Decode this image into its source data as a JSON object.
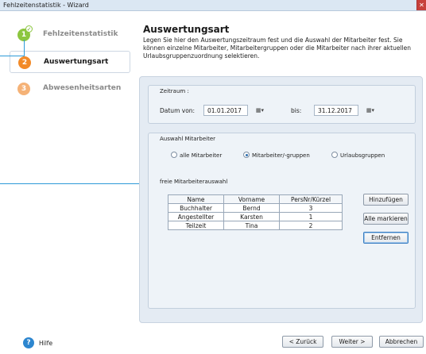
{
  "window": {
    "title": "Fehlzeitenstatistik - Wizard",
    "close_icon": "close-icon"
  },
  "sidebar": {
    "steps": [
      {
        "number": "1",
        "label": "Fehlzeitenstatistik",
        "state": "done"
      },
      {
        "number": "2",
        "label": "Auswertungsart",
        "state": "active"
      },
      {
        "number": "3",
        "label": "Abwesenheitsarten",
        "state": "todo"
      }
    ]
  },
  "header": {
    "title": "Auswertungsart",
    "description": "Legen Sie hier den Auswertungszeitraum fest und die Auswahl der Mitarbeiter fest. Sie können einzelne Mitarbeiter, Mitarbeitergruppen oder die Mitarbeiter nach ihrer aktuellen Urlaubsgruppenzuordnung selektieren."
  },
  "zeitraum": {
    "group_title": "Zeitraum :",
    "from_label": "Datum von:",
    "from_value": "01.01.2017",
    "to_label": "bis:",
    "to_value": "31.12.2017",
    "calendar_icon": "calendar-dropdown-icon"
  },
  "auswahl": {
    "group_title": "Auswahl Mitarbeiter",
    "options": [
      {
        "label": "alle Mitarbeiter",
        "checked": false
      },
      {
        "label": "Mitarbeiter/-gruppen",
        "checked": true
      },
      {
        "label": "Urlaubsgruppen",
        "checked": false
      }
    ]
  },
  "freie": {
    "title": "freie Mitarbeiterauswahl",
    "columns": [
      "Name",
      "Vorname",
      "PersNr/Kürzel"
    ],
    "rows": [
      [
        "Buchhalter",
        "Bernd",
        "3"
      ],
      [
        "Angestellter",
        "Karsten",
        "1"
      ],
      [
        "Teilzeit",
        "Tina",
        "2"
      ]
    ],
    "add_button": "Hinzufügen",
    "select_all_button": "Alle markieren",
    "remove_button": "Entfernen"
  },
  "footer": {
    "help_label": "Hilfe",
    "back_button": "< Zurück",
    "next_button": "Weiter >",
    "cancel_button": "Abbrechen"
  },
  "colors": {
    "accent": "#2d9ad8",
    "step_done": "#8cc63f",
    "step_active": "#f28a28",
    "step_todo": "#f5b277"
  }
}
